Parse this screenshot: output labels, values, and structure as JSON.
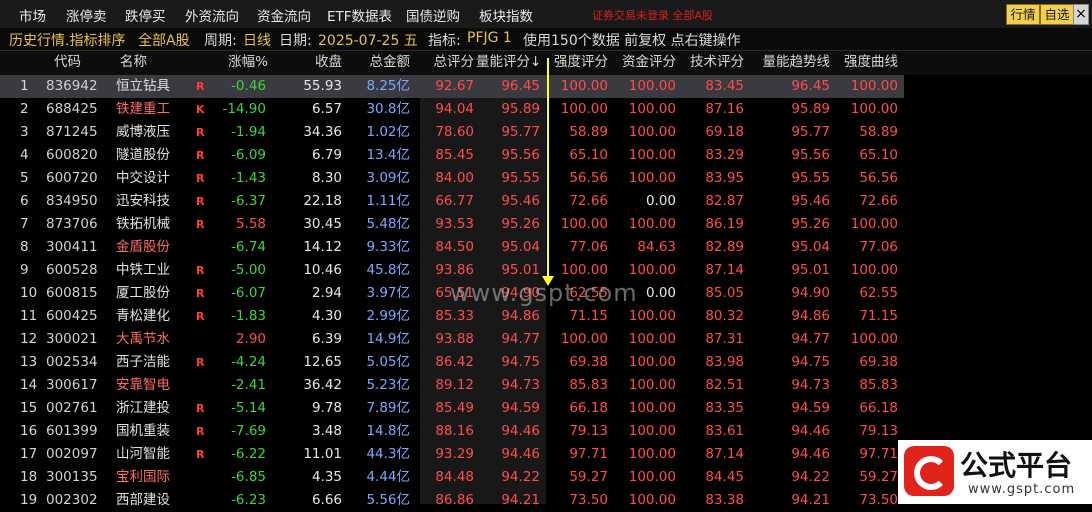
{
  "menu": {
    "items": [
      "市场",
      "涨停卖",
      "跌停买",
      "外资流向",
      "资金流向",
      "ETF数据表",
      "国债逆购",
      "板块指数"
    ],
    "notice": "证券交易未登录  全部A股",
    "buttons": [
      "行情",
      "自选"
    ],
    "close": "×"
  },
  "info": {
    "title": "历史行情.指标排序",
    "market": "全部A股",
    "period_label": "周期:",
    "period": "日线",
    "date_label": "日期:",
    "date": "2025-07-25 五",
    "indicator_label": "指标:",
    "indicator": "PFJG 1",
    "extra": "使用150个数据  前复权  点右键操作"
  },
  "table": {
    "columns": [
      "代码",
      "名称",
      "涨幅%",
      "收盘",
      "总金额",
      "总评分",
      "量能评分↓",
      "强度评分",
      "资金评分",
      "技术评分",
      "量能趋势线",
      "强度曲线"
    ],
    "rows": [
      [
        "1",
        "836942",
        "恒立钻具",
        "R",
        "-0.46",
        "55.93",
        "8.25亿",
        "92.67",
        "96.45",
        "100.00",
        "100.00",
        "83.45",
        "96.45",
        "100.00"
      ],
      [
        "2",
        "688425",
        "铁建重工",
        "K",
        "-14.90",
        "6.57",
        "30.8亿",
        "94.04",
        "95.89",
        "100.00",
        "100.00",
        "87.16",
        "95.89",
        "100.00"
      ],
      [
        "3",
        "871245",
        "威博液压",
        "R",
        "-1.94",
        "34.36",
        "1.02亿",
        "78.60",
        "95.77",
        "58.89",
        "100.00",
        "69.18",
        "95.77",
        "58.89"
      ],
      [
        "4",
        "600820",
        "隧道股份",
        "R",
        "-6.09",
        "6.79",
        "13.4亿",
        "85.45",
        "95.56",
        "65.10",
        "100.00",
        "83.29",
        "95.56",
        "65.10"
      ],
      [
        "5",
        "600720",
        "中交设计",
        "R",
        "-1.43",
        "8.30",
        "3.09亿",
        "84.00",
        "95.55",
        "56.56",
        "100.00",
        "83.95",
        "95.55",
        "56.56"
      ],
      [
        "6",
        "834950",
        "迅安科技",
        "R",
        "-6.37",
        "22.18",
        "1.11亿",
        "66.77",
        "95.46",
        "72.66",
        "0.00",
        "82.87",
        "95.46",
        "72.66"
      ],
      [
        "7",
        "873706",
        "铁拓机械",
        "R",
        "5.58",
        "30.45",
        "5.48亿",
        "93.53",
        "95.26",
        "100.00",
        "100.00",
        "86.19",
        "95.26",
        "100.00"
      ],
      [
        "8",
        "300411",
        "金盾股份",
        "",
        "-6.74",
        "14.12",
        "9.33亿",
        "84.50",
        "95.04",
        "77.06",
        "84.63",
        "82.89",
        "95.04",
        "77.06"
      ],
      [
        "9",
        "600528",
        "中铁工业",
        "R",
        "-5.00",
        "10.46",
        "45.8亿",
        "93.86",
        "95.01",
        "100.00",
        "100.00",
        "87.14",
        "95.01",
        "100.00"
      ],
      [
        "10",
        "600815",
        "厦工股份",
        "R",
        "-6.07",
        "2.94",
        "3.97亿",
        "65.51",
        "94.90",
        "62.55",
        "0.00",
        "85.05",
        "94.90",
        "62.55"
      ],
      [
        "11",
        "600425",
        "青松建化",
        "R",
        "-1.83",
        "4.30",
        "2.99亿",
        "85.33",
        "94.86",
        "71.15",
        "100.00",
        "80.32",
        "94.86",
        "71.15"
      ],
      [
        "12",
        "300021",
        "大禹节水",
        "",
        "2.90",
        "6.39",
        "14.9亿",
        "93.88",
        "94.77",
        "100.00",
        "100.00",
        "87.31",
        "94.77",
        "100.00"
      ],
      [
        "13",
        "002534",
        "西子洁能",
        "R",
        "-4.24",
        "12.65",
        "5.05亿",
        "86.42",
        "94.75",
        "69.38",
        "100.00",
        "83.98",
        "94.75",
        "69.38"
      ],
      [
        "14",
        "300617",
        "安靠智电",
        "",
        "-2.41",
        "36.42",
        "5.23亿",
        "89.12",
        "94.73",
        "85.83",
        "100.00",
        "82.51",
        "94.73",
        "85.83"
      ],
      [
        "15",
        "002761",
        "浙江建投",
        "R",
        "-5.14",
        "9.78",
        "7.89亿",
        "85.49",
        "94.59",
        "66.18",
        "100.00",
        "83.35",
        "94.59",
        "66.18"
      ],
      [
        "16",
        "601399",
        "国机重装",
        "R",
        "-7.69",
        "3.48",
        "14.8亿",
        "88.16",
        "94.46",
        "79.13",
        "100.00",
        "83.61",
        "94.46",
        "79.13"
      ],
      [
        "17",
        "002097",
        "山河智能",
        "R",
        "-6.22",
        "11.01",
        "44.3亿",
        "93.29",
        "94.46",
        "97.71",
        "100.00",
        "87.14",
        "94.46",
        "97.71"
      ],
      [
        "18",
        "300135",
        "宝利国际",
        "",
        "-6.85",
        "4.35",
        "4.44亿",
        "84.48",
        "94.22",
        "59.27",
        "100.00",
        "84.45",
        "94.22",
        "59.27"
      ],
      [
        "19",
        "002302",
        "西部建设",
        "",
        "-6.23",
        "6.66",
        "5.56亿",
        "86.86",
        "94.21",
        "73.50",
        "100.00",
        "83.38",
        "94.21",
        "73.50"
      ]
    ],
    "red_name_rows": [
      2,
      8,
      12,
      14,
      18
    ]
  },
  "watermark": "www.gspt.com",
  "logo": {
    "title": "公式平台",
    "url": "www.gspt.com"
  }
}
